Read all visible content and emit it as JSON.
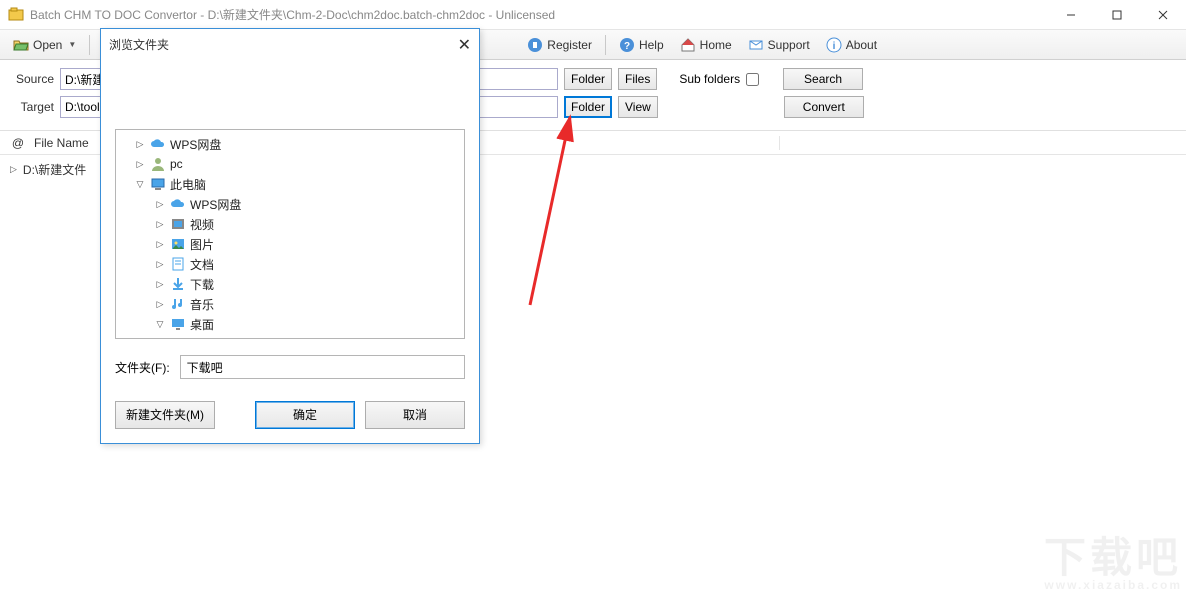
{
  "window": {
    "title": "Batch CHM TO DOC Convertor - D:\\新建文件夹\\Chm-2-Doc\\chm2doc.batch-chm2doc - Unlicensed"
  },
  "toolbar": {
    "open": "Open",
    "register": "Register",
    "help": "Help",
    "home": "Home",
    "support": "Support",
    "about": "About"
  },
  "form": {
    "source_label": "Source",
    "source_value": "D:\\新建文",
    "target_label": "Target",
    "target_value": "D:\\tools\\",
    "folder_btn": "Folder",
    "files_btn": "Files",
    "subfolders_label": "Sub folders",
    "search_btn": "Search",
    "view_btn": "View",
    "convert_btn": "Convert"
  },
  "list": {
    "at": "@",
    "col_filename": "File Name",
    "row0": "D:\\新建文件"
  },
  "dialog": {
    "title": "浏览文件夹",
    "folder_label": "文件夹(F):",
    "folder_value": "下载吧",
    "newfolder_btn": "新建文件夹(M)",
    "ok_btn": "确定",
    "cancel_btn": "取消",
    "tree": {
      "wps1": "WPS网盘",
      "pc": "pc",
      "thispc": "此电脑",
      "wps2": "WPS网盘",
      "video": "视频",
      "pictures": "图片",
      "docs": "文档",
      "downloads": "下载",
      "music": "音乐",
      "desktop": "桌面"
    }
  },
  "watermark": {
    "main": "下载吧",
    "sub": "www.xiazaiba.com"
  }
}
